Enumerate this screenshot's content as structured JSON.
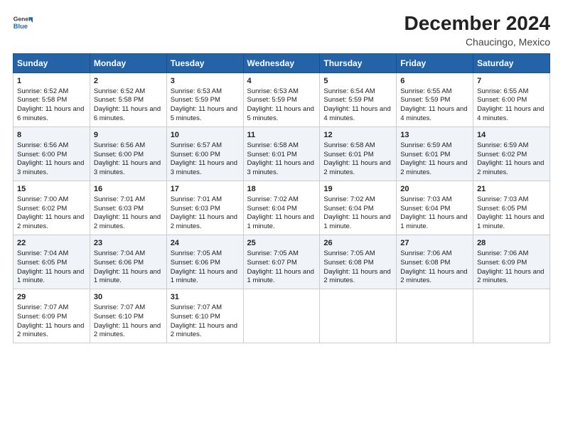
{
  "header": {
    "logo_line1": "General",
    "logo_line2": "Blue",
    "title": "December 2024",
    "subtitle": "Chaucingo, Mexico"
  },
  "columns": [
    "Sunday",
    "Monday",
    "Tuesday",
    "Wednesday",
    "Thursday",
    "Friday",
    "Saturday"
  ],
  "weeks": [
    [
      {
        "day": "1",
        "sunrise": "6:52 AM",
        "sunset": "5:58 PM",
        "daylight": "11 hours and 6 minutes."
      },
      {
        "day": "2",
        "sunrise": "6:52 AM",
        "sunset": "5:58 PM",
        "daylight": "11 hours and 6 minutes."
      },
      {
        "day": "3",
        "sunrise": "6:53 AM",
        "sunset": "5:59 PM",
        "daylight": "11 hours and 5 minutes."
      },
      {
        "day": "4",
        "sunrise": "6:53 AM",
        "sunset": "5:59 PM",
        "daylight": "11 hours and 5 minutes."
      },
      {
        "day": "5",
        "sunrise": "6:54 AM",
        "sunset": "5:59 PM",
        "daylight": "11 hours and 4 minutes."
      },
      {
        "day": "6",
        "sunrise": "6:55 AM",
        "sunset": "5:59 PM",
        "daylight": "11 hours and 4 minutes."
      },
      {
        "day": "7",
        "sunrise": "6:55 AM",
        "sunset": "6:00 PM",
        "daylight": "11 hours and 4 minutes."
      }
    ],
    [
      {
        "day": "8",
        "sunrise": "6:56 AM",
        "sunset": "6:00 PM",
        "daylight": "11 hours and 3 minutes."
      },
      {
        "day": "9",
        "sunrise": "6:56 AM",
        "sunset": "6:00 PM",
        "daylight": "11 hours and 3 minutes."
      },
      {
        "day": "10",
        "sunrise": "6:57 AM",
        "sunset": "6:00 PM",
        "daylight": "11 hours and 3 minutes."
      },
      {
        "day": "11",
        "sunrise": "6:58 AM",
        "sunset": "6:01 PM",
        "daylight": "11 hours and 3 minutes."
      },
      {
        "day": "12",
        "sunrise": "6:58 AM",
        "sunset": "6:01 PM",
        "daylight": "11 hours and 2 minutes."
      },
      {
        "day": "13",
        "sunrise": "6:59 AM",
        "sunset": "6:01 PM",
        "daylight": "11 hours and 2 minutes."
      },
      {
        "day": "14",
        "sunrise": "6:59 AM",
        "sunset": "6:02 PM",
        "daylight": "11 hours and 2 minutes."
      }
    ],
    [
      {
        "day": "15",
        "sunrise": "7:00 AM",
        "sunset": "6:02 PM",
        "daylight": "11 hours and 2 minutes."
      },
      {
        "day": "16",
        "sunrise": "7:01 AM",
        "sunset": "6:03 PM",
        "daylight": "11 hours and 2 minutes."
      },
      {
        "day": "17",
        "sunrise": "7:01 AM",
        "sunset": "6:03 PM",
        "daylight": "11 hours and 2 minutes."
      },
      {
        "day": "18",
        "sunrise": "7:02 AM",
        "sunset": "6:04 PM",
        "daylight": "11 hours and 1 minute."
      },
      {
        "day": "19",
        "sunrise": "7:02 AM",
        "sunset": "6:04 PM",
        "daylight": "11 hours and 1 minute."
      },
      {
        "day": "20",
        "sunrise": "7:03 AM",
        "sunset": "6:04 PM",
        "daylight": "11 hours and 1 minute."
      },
      {
        "day": "21",
        "sunrise": "7:03 AM",
        "sunset": "6:05 PM",
        "daylight": "11 hours and 1 minute."
      }
    ],
    [
      {
        "day": "22",
        "sunrise": "7:04 AM",
        "sunset": "6:05 PM",
        "daylight": "11 hours and 1 minute."
      },
      {
        "day": "23",
        "sunrise": "7:04 AM",
        "sunset": "6:06 PM",
        "daylight": "11 hours and 1 minute."
      },
      {
        "day": "24",
        "sunrise": "7:05 AM",
        "sunset": "6:06 PM",
        "daylight": "11 hours and 1 minute."
      },
      {
        "day": "25",
        "sunrise": "7:05 AM",
        "sunset": "6:07 PM",
        "daylight": "11 hours and 1 minute."
      },
      {
        "day": "26",
        "sunrise": "7:05 AM",
        "sunset": "6:08 PM",
        "daylight": "11 hours and 2 minutes."
      },
      {
        "day": "27",
        "sunrise": "7:06 AM",
        "sunset": "6:08 PM",
        "daylight": "11 hours and 2 minutes."
      },
      {
        "day": "28",
        "sunrise": "7:06 AM",
        "sunset": "6:09 PM",
        "daylight": "11 hours and 2 minutes."
      }
    ],
    [
      {
        "day": "29",
        "sunrise": "7:07 AM",
        "sunset": "6:09 PM",
        "daylight": "11 hours and 2 minutes."
      },
      {
        "day": "30",
        "sunrise": "7:07 AM",
        "sunset": "6:10 PM",
        "daylight": "11 hours and 2 minutes."
      },
      {
        "day": "31",
        "sunrise": "7:07 AM",
        "sunset": "6:10 PM",
        "daylight": "11 hours and 2 minutes."
      },
      null,
      null,
      null,
      null
    ]
  ]
}
